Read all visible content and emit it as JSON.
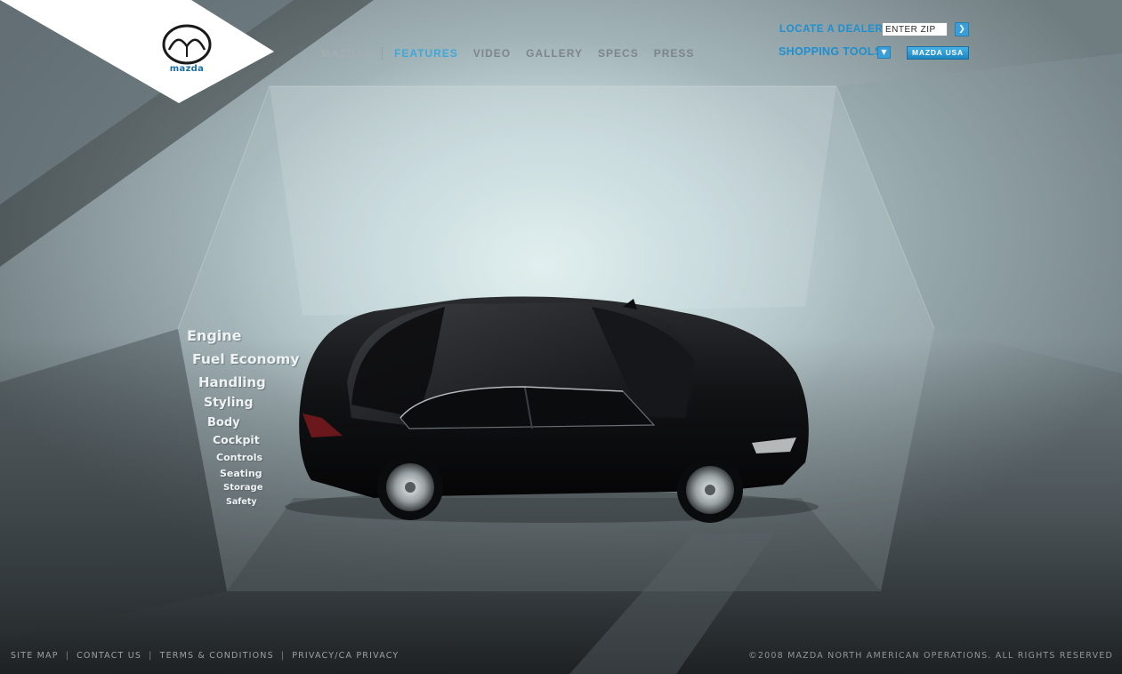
{
  "brand": {
    "wordmark": "mazda",
    "logo_icon": "mazda-emblem-icon"
  },
  "nav": {
    "model": "MAZDA6",
    "items": [
      {
        "label": "FEATURES",
        "active": true
      },
      {
        "label": "VIDEO",
        "active": false
      },
      {
        "label": "GALLERY",
        "active": false
      },
      {
        "label": "SPECS",
        "active": false
      },
      {
        "label": "PRESS",
        "active": false
      }
    ]
  },
  "dealer": {
    "label": "LOCATE A DEALER",
    "zip_placeholder": "ENTER ZIP",
    "go_icon": "arrow-right-icon"
  },
  "shopping": {
    "label": "SHOPPING TOOLS",
    "toggle_icon": "chevron-down-icon"
  },
  "mazda_usa": "MAZDA USA",
  "features": [
    "Engine",
    "Fuel Economy",
    "Handling",
    "Styling",
    "Body",
    "Cockpit",
    "Controls",
    "Seating",
    "Storage",
    "Safety"
  ],
  "footer": {
    "links": [
      "SITE MAP",
      "CONTACT US",
      "TERMS & CONDITIONS",
      "PRIVACY/CA PRIVACY"
    ],
    "separator": "|",
    "copyright": "©2008 MAZDA NORTH AMERICAN OPERATIONS. ALL RIGHTS RESERVED"
  },
  "colors": {
    "accent": "#1e8fd0",
    "active_nav": "#3fa8d8",
    "car_body": "#141517"
  }
}
